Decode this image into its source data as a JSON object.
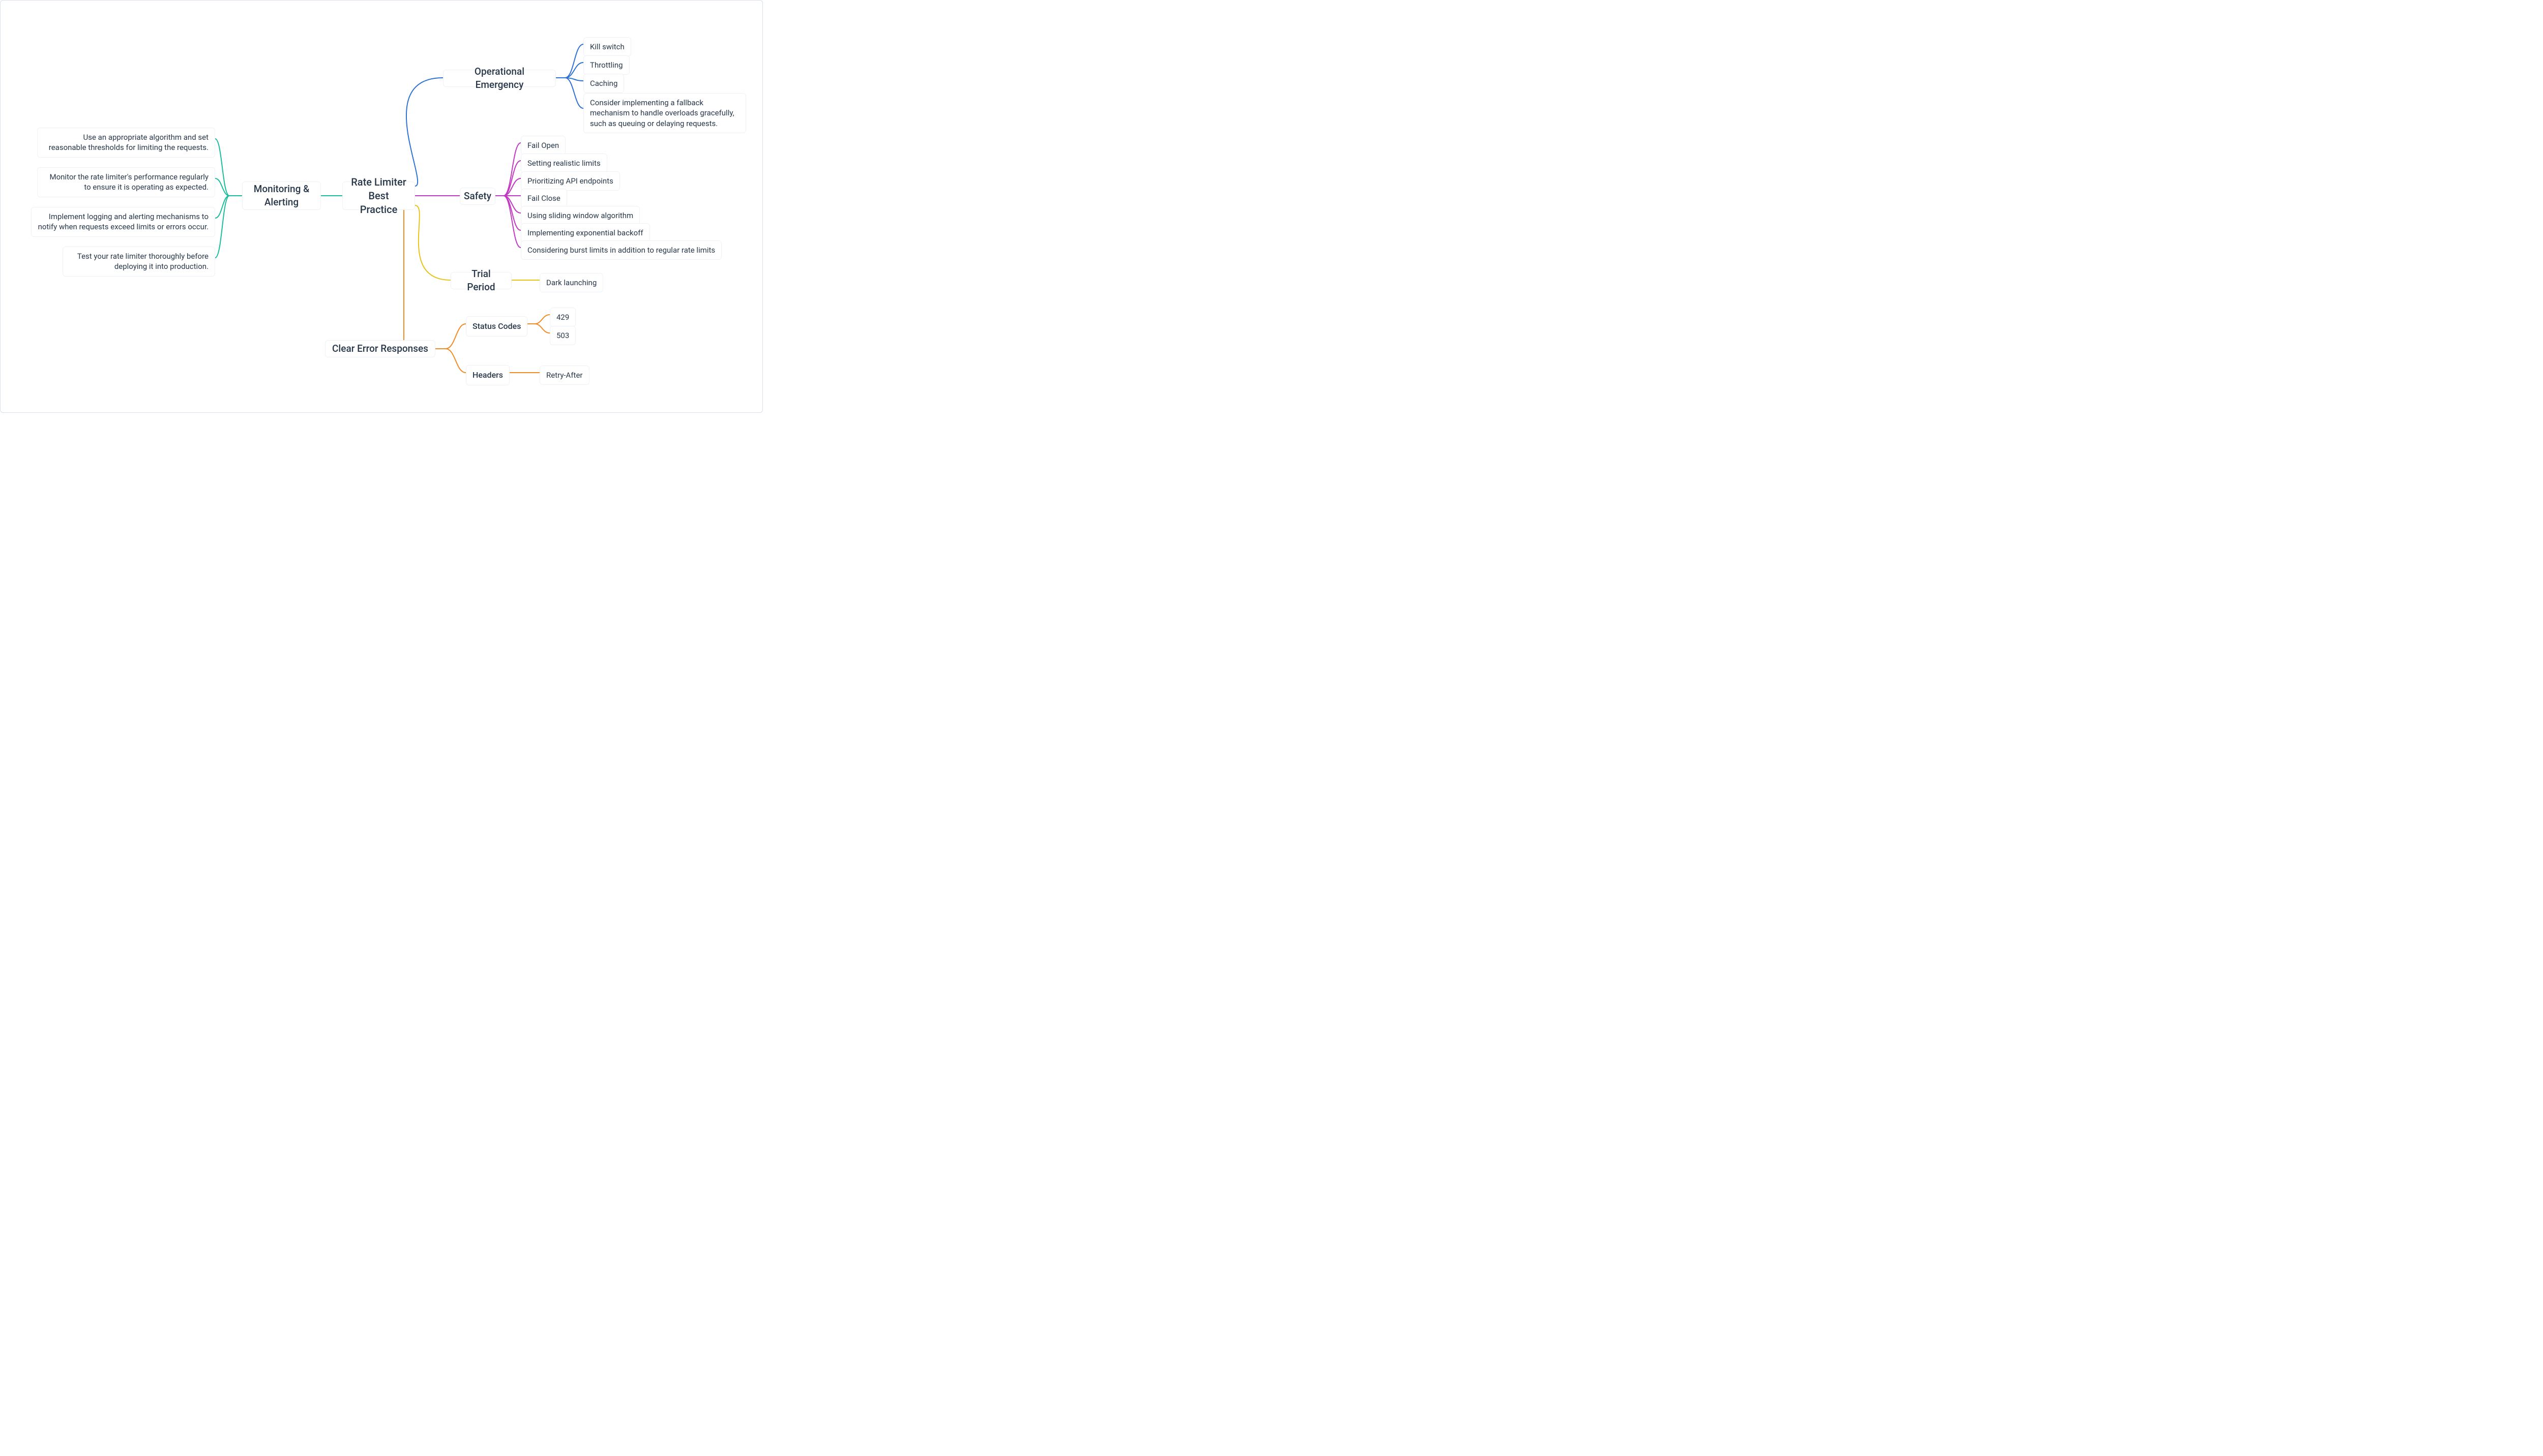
{
  "root": {
    "label": "Rate Limiter\nBest Practice"
  },
  "monitoring": {
    "label": "Monitoring &\nAlerting",
    "items": [
      "Use an appropriate algorithm and set reasonable thresholds for limiting the requests.",
      "Monitor the rate limiter's performance regularly to ensure it is operating as expected.",
      "Implement logging and alerting mechanisms to notify when requests exceed limits or errors occur.",
      "Test your rate limiter thoroughly before deploying it into production."
    ]
  },
  "opEmergency": {
    "label": "Operational Emergency",
    "items": [
      "Kill switch",
      "Throttling",
      "Caching",
      "Consider implementing a fallback mechanism to handle overloads gracefully, such as queuing or delaying requests."
    ]
  },
  "safety": {
    "label": "Safety",
    "items": [
      "Fail Open",
      "Setting realistic limits",
      "Prioritizing API endpoints",
      "Fail Close",
      "Using sliding window algorithm",
      "Implementing exponential backoff",
      "Considering burst limits in addition to regular rate limits"
    ]
  },
  "trial": {
    "label": "Trial Period",
    "items": [
      "Dark launching"
    ]
  },
  "errors": {
    "label": "Clear Error Responses",
    "status": {
      "label": "Status Codes",
      "items": [
        "429",
        "503"
      ]
    },
    "headers": {
      "label": "Headers",
      "items": [
        "Retry-After"
      ]
    }
  },
  "colors": {
    "monitoring": "#1abc9c",
    "opEmergency": "#2e72d2",
    "safety": "#c039c0",
    "trial": "#e8c31a",
    "errors": "#f08c28"
  },
  "chart_data": {
    "type": "mindmap",
    "root": "Rate Limiter Best Practice",
    "branches": [
      {
        "name": "Monitoring & Alerting",
        "side": "left",
        "color": "#1abc9c",
        "children": [
          "Use an appropriate algorithm and set reasonable thresholds for limiting the requests.",
          "Monitor the rate limiter's performance regularly to ensure it is operating as expected.",
          "Implement logging and alerting mechanisms to notify when requests exceed limits or errors occur.",
          "Test your rate limiter thoroughly before deploying it into production."
        ]
      },
      {
        "name": "Operational Emergency",
        "side": "right",
        "color": "#2e72d2",
        "children": [
          "Kill switch",
          "Throttling",
          "Caching",
          "Consider implementing a fallback mechanism to handle overloads gracefully, such as queuing or delaying requests."
        ]
      },
      {
        "name": "Safety",
        "side": "right",
        "color": "#c039c0",
        "children": [
          "Fail Open",
          "Setting realistic limits",
          "Prioritizing API endpoints",
          "Fail Close",
          "Using sliding window algorithm",
          "Implementing exponential backoff",
          "Considering burst limits in addition to regular rate limits"
        ]
      },
      {
        "name": "Trial Period",
        "side": "right",
        "color": "#e8c31a",
        "children": [
          "Dark launching"
        ]
      },
      {
        "name": "Clear Error Responses",
        "side": "right",
        "color": "#f08c28",
        "children": [
          {
            "name": "Status Codes",
            "children": [
              "429",
              "503"
            ]
          },
          {
            "name": "Headers",
            "children": [
              "Retry-After"
            ]
          }
        ]
      }
    ]
  }
}
